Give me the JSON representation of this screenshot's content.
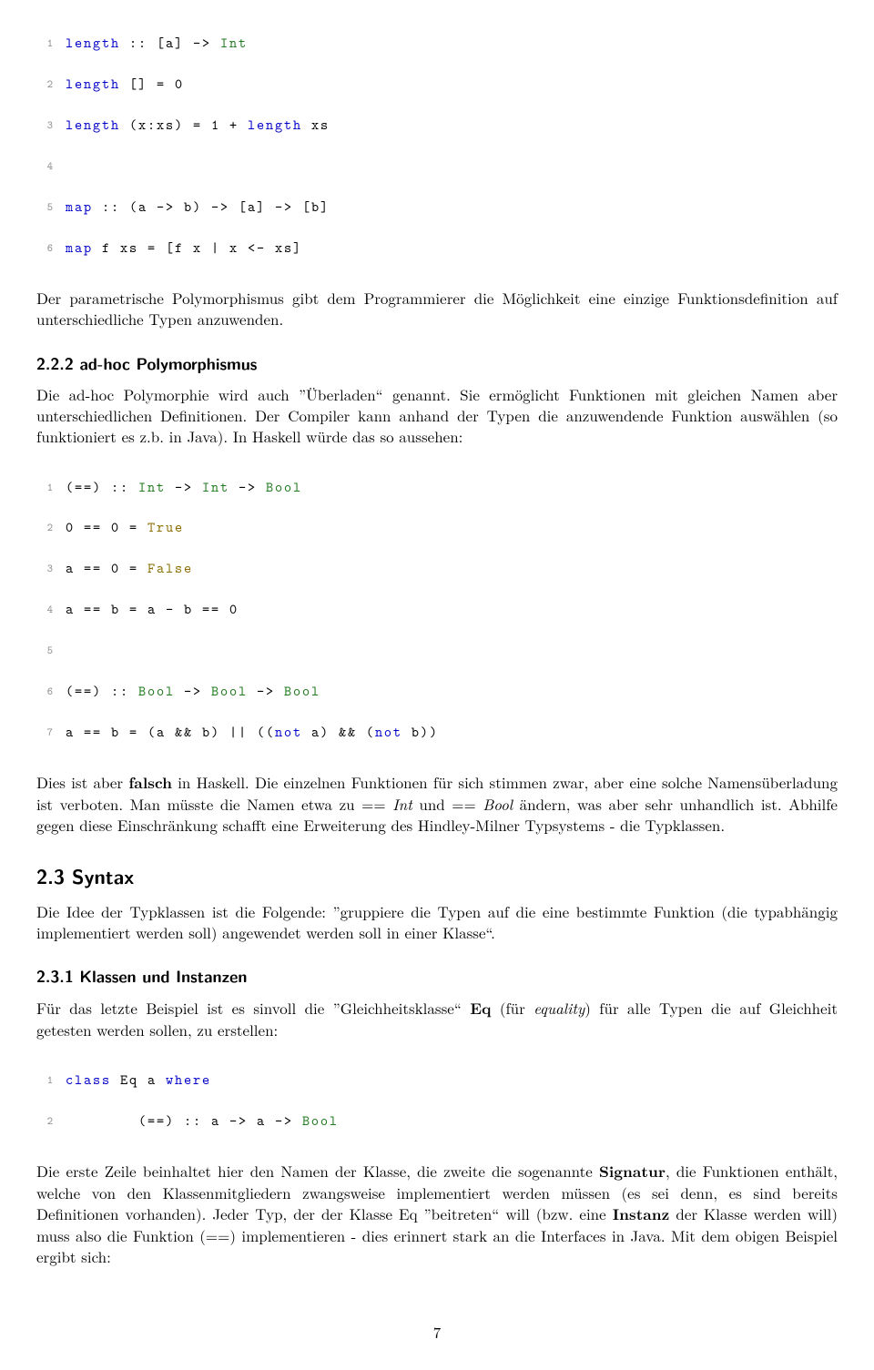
{
  "code1": {
    "l1a": "length",
    "l1b": " :: [a] -> ",
    "l1c": "Int",
    "l2a": "length",
    "l2b": " [] = 0",
    "l3a": "length",
    "l3b": " (x:xs) = 1 + ",
    "l3c": "length",
    "l3d": " xs",
    "l5a": "map",
    "l5b": " :: (a -> b) -> [a] -> [b]",
    "l6a": "map",
    "l6b": " f xs = [f x | x <- xs]"
  },
  "para1": "Der parametrische Polymorphismus gibt dem Programmierer die Möglichkeit eine einzige Funktionsdefinition auf unterschiedliche Typen anzuwenden.",
  "h222": "2.2.2 ad-hoc Polymorphismus",
  "para2": "Die ad-hoc Polymorphie wird auch ”Überladen“ genannt. Sie ermöglicht Funktionen mit gleichen Namen aber unterschiedlichen Definitionen. Der Compiler kann anhand der Typen die anzuwendende Funktion auswählen (so funktioniert es z.b. in Java). In Haskell würde das so aussehen:",
  "code2": {
    "l1a": "(==) :: ",
    "l1b": "Int",
    "l1c": " -> ",
    "l1d": "Int",
    "l1e": " -> ",
    "l1f": "Bool",
    "l2a": "0 == 0 = ",
    "l2b": "True",
    "l3a": "a == 0 = ",
    "l3b": "False",
    "l4": "a == b = a - b == 0",
    "l6a": "(==) :: ",
    "l6b": "Bool",
    "l6c": " -> ",
    "l6d": "Bool",
    "l6e": " -> ",
    "l6f": "Bool",
    "l7a": "a == b = (a && b) || ((",
    "l7b": "not",
    "l7c": " a) && (",
    "l7d": "not",
    "l7e": " b))"
  },
  "para3a": "Dies ist aber ",
  "para3b": "falsch",
  "para3c": " in Haskell. Die einzelnen Funktionen für sich stimmen zwar, aber eine solche Namensüberladung ist verboten. Man müsste die Namen etwa zu == ",
  "para3d": "Int",
  "para3e": " und == ",
  "para3f": "Bool",
  "para3g": " ändern, was aber sehr unhandlich ist. Abhilfe gegen diese Einschränkung schafft eine Erweiterung des Hindley-Milner Typsystems - die Typklassen.",
  "h23": "2.3 Syntax",
  "para4": "Die Idee der Typklassen ist die Folgende: ”gruppiere die Typen auf die eine bestimmte Funktion (die typabhängig implementiert werden soll) angewendet werden soll in einer Klasse“.",
  "h231": "2.3.1 Klassen und Instanzen",
  "para5a": "Für das letzte Beispiel ist es sinvoll die ”Gleichheitsklasse“ ",
  "para5b": "Eq",
  "para5c": " (für ",
  "para5d": "equality",
  "para5e": ") für alle Typen die auf Gleichheit getesten werden sollen, zu erstellen:",
  "code3": {
    "l1a": "class",
    "l1b": " Eq a ",
    "l1c": "where",
    "l2a": "        (==) :: a -> a -> ",
    "l2b": "Bool"
  },
  "para6a": "Die erste Zeile beinhaltet hier den Namen der Klasse, die zweite die sogenannte ",
  "para6b": "Signatur",
  "para6c": ", die Funktionen enthält, welche von den Klassenmitgliedern zwangsweise implementiert werden müssen (es sei denn, es sind bereits Definitionen vorhanden). Jeder Typ, der der Klasse Eq ”beitreten“ will (bzw. eine ",
  "para6d": "Instanz",
  "para6e": " der Klasse werden will) muss also die Funktion (==) implementieren - dies erinnert stark an die Interfaces in Java. Mit dem obigen Beispiel ergibt sich:",
  "pagenum": "7"
}
